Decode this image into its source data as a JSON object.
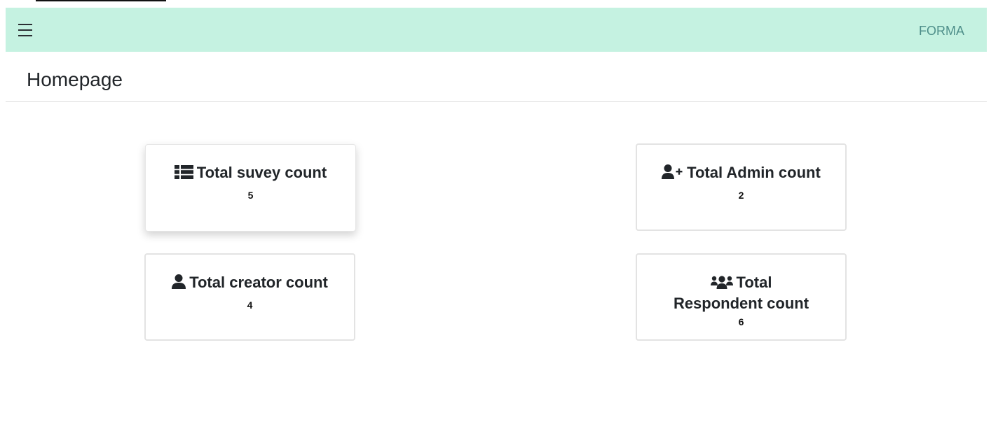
{
  "app": {
    "brand": "FORMA"
  },
  "page": {
    "title": "Homepage"
  },
  "cards": {
    "survey": {
      "label": "Total suvey count",
      "value": "5",
      "icon": "list-icon"
    },
    "admin": {
      "label": "Total Admin count",
      "value": "2",
      "icon": "user-plus-icon"
    },
    "creator": {
      "label": "Total creator count",
      "value": "4",
      "icon": "user-icon"
    },
    "respondent": {
      "label": "Total Respondent count",
      "value": "6",
      "icon": "users-icon"
    }
  },
  "colors": {
    "navbar": "#c5f2e1",
    "brand": "#4f8f8a"
  }
}
